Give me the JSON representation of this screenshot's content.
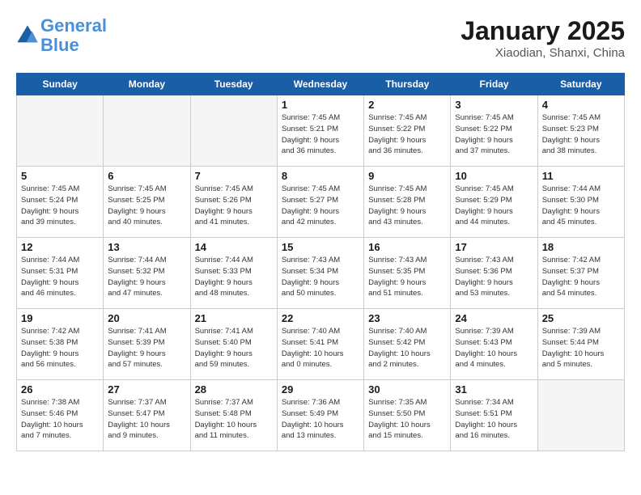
{
  "header": {
    "logo_line1": "General",
    "logo_line2": "Blue",
    "title": "January 2025",
    "subtitle": "Xiaodian, Shanxi, China"
  },
  "days_of_week": [
    "Sunday",
    "Monday",
    "Tuesday",
    "Wednesday",
    "Thursday",
    "Friday",
    "Saturday"
  ],
  "weeks": [
    [
      {
        "day": "",
        "info": ""
      },
      {
        "day": "",
        "info": ""
      },
      {
        "day": "",
        "info": ""
      },
      {
        "day": "1",
        "info": "Sunrise: 7:45 AM\nSunset: 5:21 PM\nDaylight: 9 hours\nand 36 minutes."
      },
      {
        "day": "2",
        "info": "Sunrise: 7:45 AM\nSunset: 5:22 PM\nDaylight: 9 hours\nand 36 minutes."
      },
      {
        "day": "3",
        "info": "Sunrise: 7:45 AM\nSunset: 5:22 PM\nDaylight: 9 hours\nand 37 minutes."
      },
      {
        "day": "4",
        "info": "Sunrise: 7:45 AM\nSunset: 5:23 PM\nDaylight: 9 hours\nand 38 minutes."
      }
    ],
    [
      {
        "day": "5",
        "info": "Sunrise: 7:45 AM\nSunset: 5:24 PM\nDaylight: 9 hours\nand 39 minutes."
      },
      {
        "day": "6",
        "info": "Sunrise: 7:45 AM\nSunset: 5:25 PM\nDaylight: 9 hours\nand 40 minutes."
      },
      {
        "day": "7",
        "info": "Sunrise: 7:45 AM\nSunset: 5:26 PM\nDaylight: 9 hours\nand 41 minutes."
      },
      {
        "day": "8",
        "info": "Sunrise: 7:45 AM\nSunset: 5:27 PM\nDaylight: 9 hours\nand 42 minutes."
      },
      {
        "day": "9",
        "info": "Sunrise: 7:45 AM\nSunset: 5:28 PM\nDaylight: 9 hours\nand 43 minutes."
      },
      {
        "day": "10",
        "info": "Sunrise: 7:45 AM\nSunset: 5:29 PM\nDaylight: 9 hours\nand 44 minutes."
      },
      {
        "day": "11",
        "info": "Sunrise: 7:44 AM\nSunset: 5:30 PM\nDaylight: 9 hours\nand 45 minutes."
      }
    ],
    [
      {
        "day": "12",
        "info": "Sunrise: 7:44 AM\nSunset: 5:31 PM\nDaylight: 9 hours\nand 46 minutes."
      },
      {
        "day": "13",
        "info": "Sunrise: 7:44 AM\nSunset: 5:32 PM\nDaylight: 9 hours\nand 47 minutes."
      },
      {
        "day": "14",
        "info": "Sunrise: 7:44 AM\nSunset: 5:33 PM\nDaylight: 9 hours\nand 48 minutes."
      },
      {
        "day": "15",
        "info": "Sunrise: 7:43 AM\nSunset: 5:34 PM\nDaylight: 9 hours\nand 50 minutes."
      },
      {
        "day": "16",
        "info": "Sunrise: 7:43 AM\nSunset: 5:35 PM\nDaylight: 9 hours\nand 51 minutes."
      },
      {
        "day": "17",
        "info": "Sunrise: 7:43 AM\nSunset: 5:36 PM\nDaylight: 9 hours\nand 53 minutes."
      },
      {
        "day": "18",
        "info": "Sunrise: 7:42 AM\nSunset: 5:37 PM\nDaylight: 9 hours\nand 54 minutes."
      }
    ],
    [
      {
        "day": "19",
        "info": "Sunrise: 7:42 AM\nSunset: 5:38 PM\nDaylight: 9 hours\nand 56 minutes."
      },
      {
        "day": "20",
        "info": "Sunrise: 7:41 AM\nSunset: 5:39 PM\nDaylight: 9 hours\nand 57 minutes."
      },
      {
        "day": "21",
        "info": "Sunrise: 7:41 AM\nSunset: 5:40 PM\nDaylight: 9 hours\nand 59 minutes."
      },
      {
        "day": "22",
        "info": "Sunrise: 7:40 AM\nSunset: 5:41 PM\nDaylight: 10 hours\nand 0 minutes."
      },
      {
        "day": "23",
        "info": "Sunrise: 7:40 AM\nSunset: 5:42 PM\nDaylight: 10 hours\nand 2 minutes."
      },
      {
        "day": "24",
        "info": "Sunrise: 7:39 AM\nSunset: 5:43 PM\nDaylight: 10 hours\nand 4 minutes."
      },
      {
        "day": "25",
        "info": "Sunrise: 7:39 AM\nSunset: 5:44 PM\nDaylight: 10 hours\nand 5 minutes."
      }
    ],
    [
      {
        "day": "26",
        "info": "Sunrise: 7:38 AM\nSunset: 5:46 PM\nDaylight: 10 hours\nand 7 minutes."
      },
      {
        "day": "27",
        "info": "Sunrise: 7:37 AM\nSunset: 5:47 PM\nDaylight: 10 hours\nand 9 minutes."
      },
      {
        "day": "28",
        "info": "Sunrise: 7:37 AM\nSunset: 5:48 PM\nDaylight: 10 hours\nand 11 minutes."
      },
      {
        "day": "29",
        "info": "Sunrise: 7:36 AM\nSunset: 5:49 PM\nDaylight: 10 hours\nand 13 minutes."
      },
      {
        "day": "30",
        "info": "Sunrise: 7:35 AM\nSunset: 5:50 PM\nDaylight: 10 hours\nand 15 minutes."
      },
      {
        "day": "31",
        "info": "Sunrise: 7:34 AM\nSunset: 5:51 PM\nDaylight: 10 hours\nand 16 minutes."
      },
      {
        "day": "",
        "info": ""
      }
    ]
  ]
}
